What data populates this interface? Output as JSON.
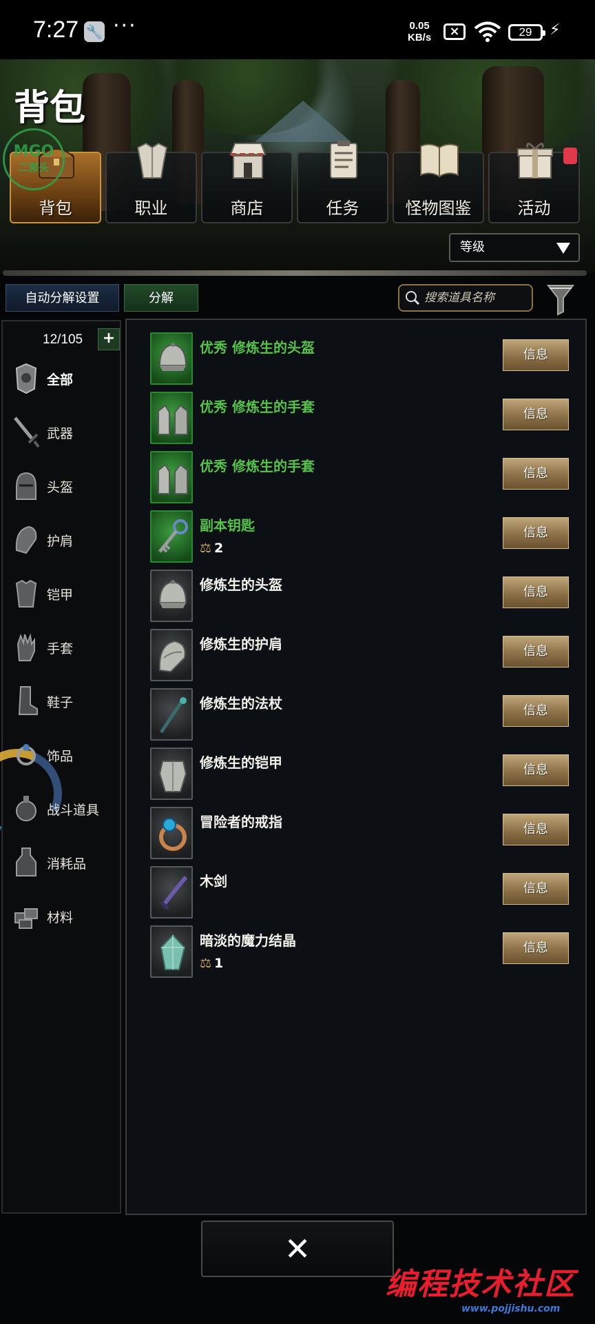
{
  "status_bar": {
    "time": "7:27",
    "speed_value": "0.05",
    "speed_unit": "KB/s",
    "battery": "29"
  },
  "header": {
    "title": "背包",
    "watermark_badge": {
      "line1": "MGO",
      "line2": "二郭头"
    }
  },
  "tabs": [
    {
      "label": "背包",
      "icon": "chest-icon",
      "active": true
    },
    {
      "label": "职业",
      "icon": "armor-icon"
    },
    {
      "label": "商店",
      "icon": "shop-icon"
    },
    {
      "label": "任务",
      "icon": "quest-icon"
    },
    {
      "label": "怪物图鉴",
      "icon": "book-icon"
    },
    {
      "label": "活动",
      "icon": "gift-icon",
      "has_notification": true
    }
  ],
  "sort": {
    "selected": "等级"
  },
  "toolbar": {
    "auto_decompose_label": "自动分解设置",
    "decompose_label": "分解",
    "search_placeholder": "搜索道具名称"
  },
  "sidebar": {
    "count": "12/105",
    "plus_label": "+",
    "categories": [
      {
        "label": "全部",
        "icon": "all-icon",
        "active": true
      },
      {
        "label": "武器",
        "icon": "sword-icon"
      },
      {
        "label": "头盔",
        "icon": "helmet-icon"
      },
      {
        "label": "护肩",
        "icon": "shoulder-icon"
      },
      {
        "label": "铠甲",
        "icon": "armor-icon"
      },
      {
        "label": "手套",
        "icon": "glove-icon"
      },
      {
        "label": "鞋子",
        "icon": "boot-icon"
      },
      {
        "label": "饰品",
        "icon": "accessory-icon"
      },
      {
        "label": "战斗道具",
        "icon": "combat-item-icon"
      },
      {
        "label": "消耗品",
        "icon": "consumable-icon"
      },
      {
        "label": "材料",
        "icon": "material-icon"
      }
    ]
  },
  "items": [
    {
      "name": "优秀 修炼生的头盔",
      "rarity": "green",
      "icon": "helmet-icon",
      "info_label": "信息"
    },
    {
      "name": "优秀 修炼生的手套",
      "rarity": "green",
      "icon": "glove-icon",
      "info_label": "信息"
    },
    {
      "name": "优秀 修炼生的手套",
      "rarity": "green",
      "icon": "glove-icon",
      "info_label": "信息"
    },
    {
      "name": "副本钥匙",
      "rarity": "green",
      "icon": "key-icon",
      "quantity": "2",
      "info_label": "信息"
    },
    {
      "name": "修炼生的头盔",
      "rarity": "normal",
      "icon": "helmet-icon",
      "info_label": "信息"
    },
    {
      "name": "修炼生的护肩",
      "rarity": "normal",
      "icon": "shoulder-icon",
      "info_label": "信息"
    },
    {
      "name": "修炼生的法杖",
      "rarity": "normal",
      "icon": "staff-icon",
      "info_label": "信息"
    },
    {
      "name": "修炼生的铠甲",
      "rarity": "normal",
      "icon": "armor-icon",
      "info_label": "信息"
    },
    {
      "name": "冒险者的戒指",
      "rarity": "normal",
      "icon": "ring-icon",
      "info_label": "信息"
    },
    {
      "name": "木剑",
      "rarity": "normal",
      "icon": "sword-icon",
      "info_label": "信息"
    },
    {
      "name": "暗淡的魔力结晶",
      "rarity": "normal",
      "icon": "crystal-icon",
      "quantity": "1",
      "info_label": "信息"
    }
  ],
  "close_label": "✕",
  "watermark": {
    "text": "编程技术社区",
    "url": "www.pojjishu.com"
  },
  "colors": {
    "rare_green": "#55c24a",
    "info_gold": "#bfa57a",
    "accent_orange": "#a86f2a",
    "notify_red": "#e0394a"
  }
}
